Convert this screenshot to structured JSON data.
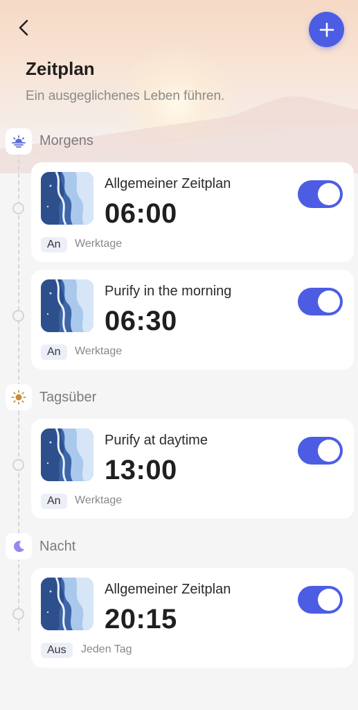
{
  "header": {
    "title": "Zeitplan",
    "subtitle": "Ein ausgeglichenes Leben führen."
  },
  "colors": {
    "accent": "#4c5de4",
    "badge_bg": "#eceef8"
  },
  "sections": [
    {
      "label": "Morgens",
      "icon": "sunrise-icon",
      "items": [
        {
          "name": "Allgemeiner Zeitplan",
          "time": "06:00",
          "status": "An",
          "repeat": "Werktage",
          "enabled": true
        },
        {
          "name": "Purify in the morning",
          "time": "06:30",
          "status": "An",
          "repeat": "Werktage",
          "enabled": true
        }
      ]
    },
    {
      "label": "Tagsüber",
      "icon": "sun-icon",
      "items": [
        {
          "name": "Purify at daytime",
          "time": "13:00",
          "status": "An",
          "repeat": "Werktage",
          "enabled": true
        }
      ]
    },
    {
      "label": "Nacht",
      "icon": "moon-icon",
      "items": [
        {
          "name": "Allgemeiner Zeitplan",
          "time": "20:15",
          "status": "Aus",
          "repeat": "Jeden Tag",
          "enabled": true
        }
      ]
    }
  ]
}
